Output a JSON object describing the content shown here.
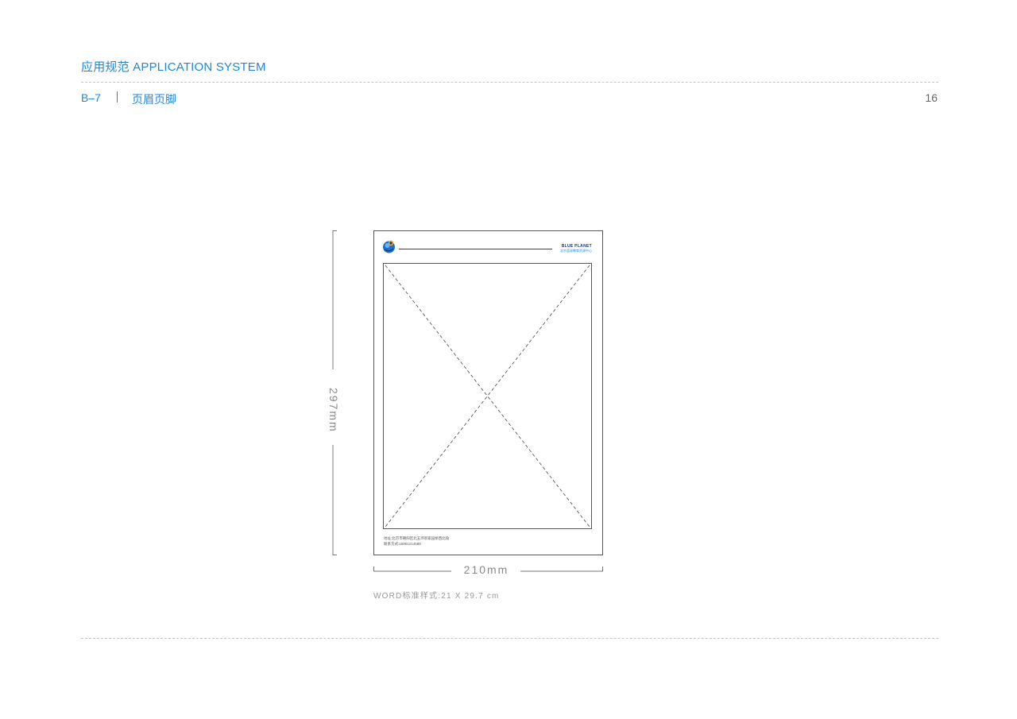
{
  "header": {
    "title": "应用规范 APPLICATION SYSTEM",
    "section_code": "B–7",
    "section_title": "页眉页脚",
    "page_number": "16"
  },
  "letterhead": {
    "brand_name": "BLUE PLANET",
    "brand_subtitle": "北京蓝球教育资源中心",
    "address": "地址:北京市朝阳区北五环新家园桥西北角",
    "phone": "联系方式:15901214588"
  },
  "dimensions": {
    "height_label": "297mm",
    "width_label": "210mm",
    "format_note": "WORD标准样式:21 X 29.7 cm"
  },
  "colors": {
    "accent": "#1e88d8",
    "brand_dark": "#1a3a8a",
    "rule": "#c4c4c4"
  },
  "icons": {
    "logo": "globe-logo-icon"
  }
}
